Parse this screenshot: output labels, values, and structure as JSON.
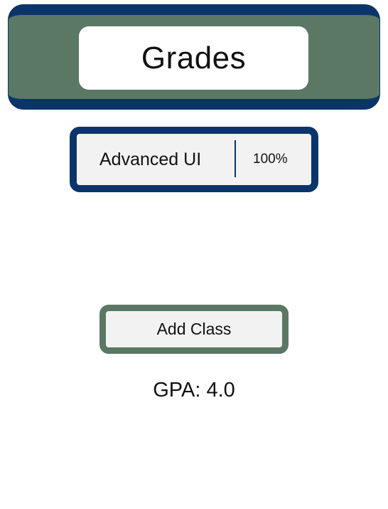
{
  "header": {
    "title": "Grades"
  },
  "classes": [
    {
      "name": "Advanced UI",
      "grade": "100%"
    }
  ],
  "actions": {
    "add_class_label": "Add Class"
  },
  "summary": {
    "gpa_text": "GPA: 4.0"
  },
  "colors": {
    "navy": "#0b356a",
    "green": "#5a7864",
    "card_background": "#f2f2f2"
  }
}
